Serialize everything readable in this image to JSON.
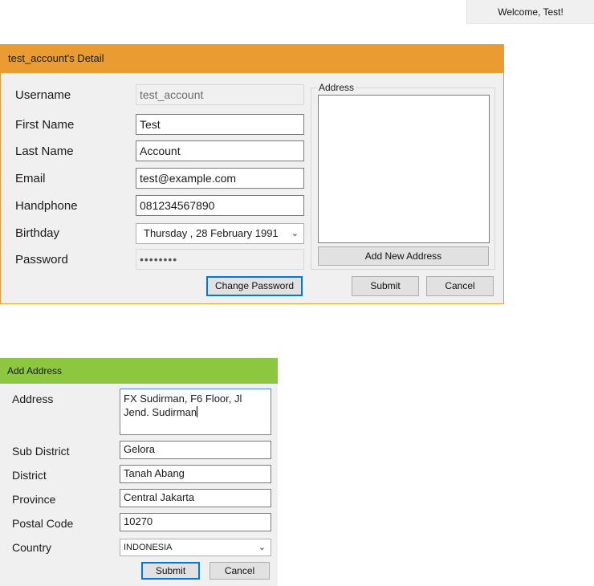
{
  "header": {
    "welcome": "Welcome, Test!"
  },
  "detail_form": {
    "title": "test_account's Detail",
    "labels": {
      "username": "Username",
      "first_name": "First Name",
      "last_name": "Last Name",
      "email": "Email",
      "handphone": "Handphone",
      "birthday": "Birthday",
      "password": "Password"
    },
    "values": {
      "username": "test_account",
      "first_name": "Test",
      "last_name": "Account",
      "email": "test@example.com",
      "handphone": "081234567890",
      "birthday": "Thursday  , 28  February  1991",
      "password": "••••••••"
    },
    "address_group_label": "Address",
    "buttons": {
      "add_new_address": "Add New Address",
      "change_password": "Change Password",
      "submit": "Submit",
      "cancel": "Cancel"
    },
    "accent_color": "#ea9c32"
  },
  "add_address_form": {
    "title": "Add Address",
    "labels": {
      "address": "Address",
      "sub_district": "Sub District",
      "district": "District",
      "province": "Province",
      "postal_code": "Postal Code",
      "country": "Country"
    },
    "values": {
      "address_line1": "FX Sudirman, F6 Floor, Jl",
      "address_line2": "Jend. Sudirman",
      "sub_district": "Gelora",
      "district": "Tanah Abang",
      "province": "Central Jakarta",
      "postal_code": "10270",
      "country": "INDONESIA"
    },
    "buttons": {
      "submit": "Submit",
      "cancel": "Cancel"
    },
    "accent_color": "#8dc63f"
  }
}
